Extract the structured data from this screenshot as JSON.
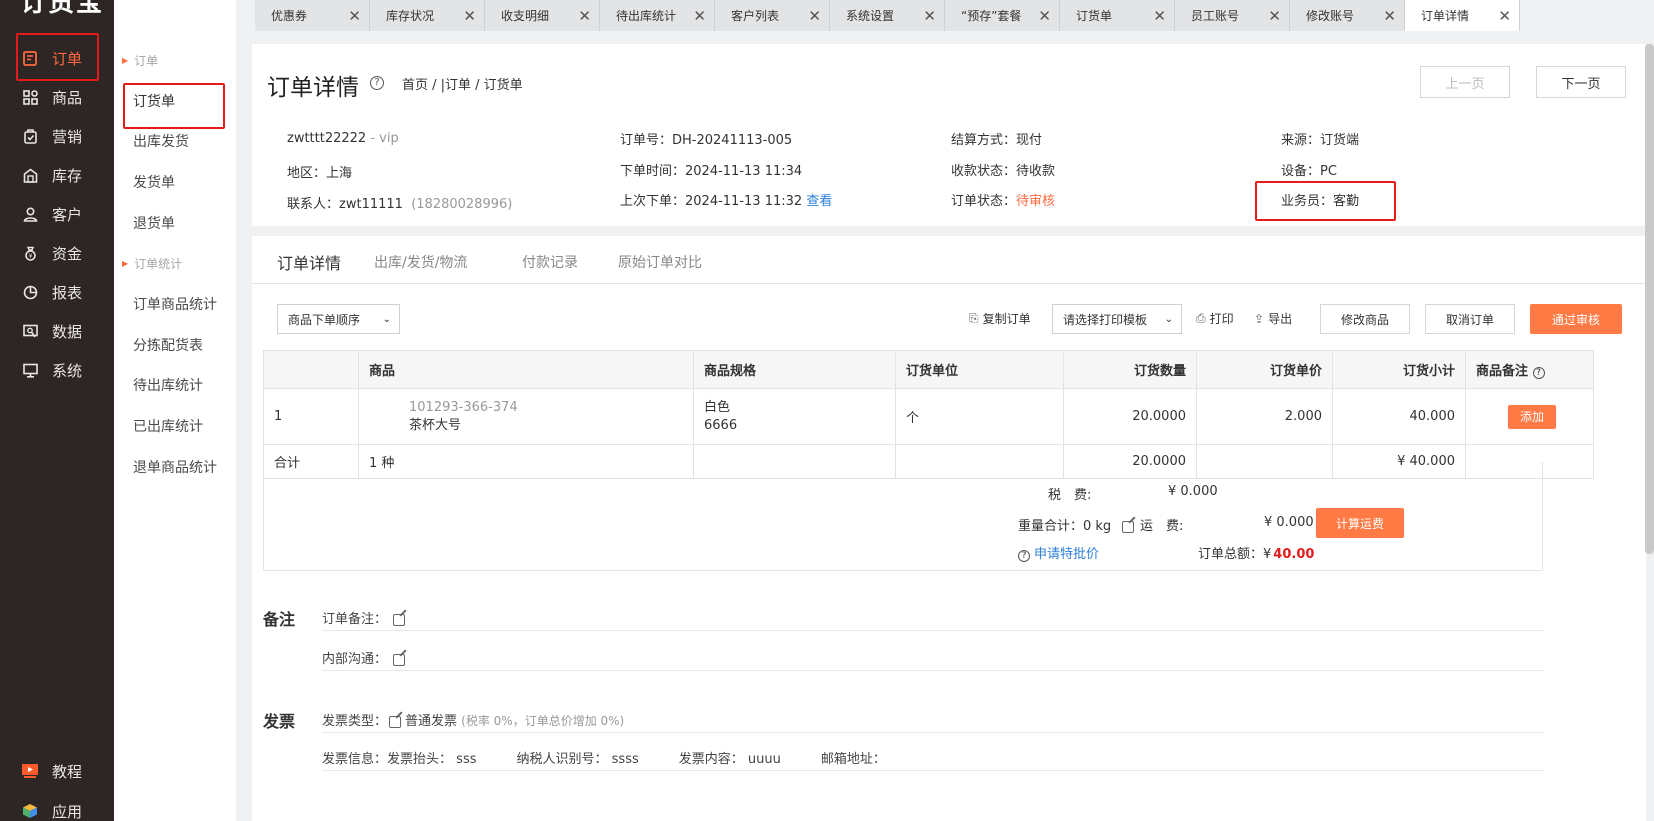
{
  "app": {
    "logo": "订货宝"
  },
  "sidebar": {
    "items": [
      {
        "label": "订单",
        "icon": "order-icon"
      },
      {
        "label": "商品",
        "icon": "goods-icon"
      },
      {
        "label": "营销",
        "icon": "marketing-icon"
      },
      {
        "label": "库存",
        "icon": "warehouse-icon"
      },
      {
        "label": "客户",
        "icon": "user-icon"
      },
      {
        "label": "资金",
        "icon": "money-bag-icon"
      },
      {
        "label": "报表",
        "icon": "pie-chart-icon"
      },
      {
        "label": "数据",
        "icon": "data-icon"
      },
      {
        "label": "系统",
        "icon": "monitor-icon"
      }
    ],
    "bottom": [
      {
        "label": "教程",
        "icon": "video-icon"
      },
      {
        "label": "应用",
        "icon": "cube-icon"
      }
    ]
  },
  "subnav": {
    "group1": "订单",
    "group1_items": [
      "订货单",
      "出库发货",
      "发货单",
      "退货单"
    ],
    "group2": "订单统计",
    "group2_items": [
      "订单商品统计",
      "分拣配货表",
      "待出库统计",
      "已出库统计",
      "退单商品统计"
    ]
  },
  "tabs": [
    "优惠券",
    "库存状况",
    "收支明细",
    "待出库统计",
    "客户列表",
    "系统设置",
    "“预存”套餐",
    "订货单",
    "员工账号",
    "修改账号",
    "订单详情"
  ],
  "header": {
    "title": "订单详情",
    "help": "?",
    "breadcrumb": "首页 / |订单 / 订货单",
    "prev": "上一页",
    "next": "下一页"
  },
  "info": {
    "customer": "zwtttt22222",
    "level": " - vip",
    "region_label": "地区：",
    "region": "上海",
    "contact_label": "联系人：",
    "contact": "zwt11111",
    "phone": "(18280028996)",
    "order_no_label": "订单号：",
    "order_no": "DH-20241113-005",
    "order_time_label": "下单时间：",
    "order_time": "2024-11-13 11:34",
    "last_order_label": "上次下单：",
    "last_order": "2024-11-13 11:32",
    "view": "查看",
    "settle_label": "结算方式：",
    "settle": "现付",
    "pay_status_label": "收款状态：",
    "pay_status": "待收款",
    "order_status_label": "订单状态：",
    "order_status": "待审核",
    "source_label": "来源：",
    "source": "订货端",
    "device_label": "设备：",
    "device": "PC",
    "salesman_label": "业务员：",
    "salesman": "客勤"
  },
  "detail_tabs": [
    "订单详情",
    "出库/发货/物流",
    "付款记录",
    "原始订单对比"
  ],
  "toolbar": {
    "sort": "商品下单顺序",
    "copy": "复制订单",
    "print_tpl": "请选择打印模板",
    "print": "打印",
    "export": "导出",
    "edit_goods": "修改商品",
    "cancel_order": "取消订单",
    "approve": "通过审核"
  },
  "table": {
    "headers": [
      "",
      "商品",
      "商品规格",
      "订货单位",
      "订货数量",
      "订货单价",
      "订货小计",
      "商品备注"
    ],
    "rows": [
      {
        "idx": "1",
        "code": "101293-366-374",
        "name": "茶杯大号",
        "spec1": "白色",
        "spec2": "6666",
        "unit": "个",
        "qty": "20.0000",
        "price": "2.000",
        "subtotal": "40.000",
        "note_btn": "添加"
      }
    ],
    "sum": {
      "label": "合计",
      "kinds": "1 种",
      "qty": "20.0000",
      "subtotal": "¥ 40.000"
    }
  },
  "totals": {
    "tax_label": "税　费:",
    "tax": "¥ 0.000",
    "weight": "重量合计：0 kg",
    "freight_label": "运　费:",
    "freight": "¥ 0.000",
    "calc_btn": "计算运费",
    "apply": "申请特批价",
    "total_label": "订单总额：",
    "total_sym": "¥",
    "total": "40.00"
  },
  "remark": {
    "title": "备注",
    "order_note": "订单备注：",
    "internal": "内部沟通："
  },
  "invoice": {
    "title": "发票",
    "type_label": "发票类型：",
    "type": "普通发票",
    "type_note": "(税率 0%，订单总价增加 0%)",
    "info_label": "发票信息：",
    "head_label": "发票抬头：",
    "head": "sss",
    "tax_no_label": "纳税人识别号：",
    "tax_no": "ssss",
    "content_label": "发票内容：",
    "content": "uuuu",
    "mail_label": "邮箱地址："
  }
}
